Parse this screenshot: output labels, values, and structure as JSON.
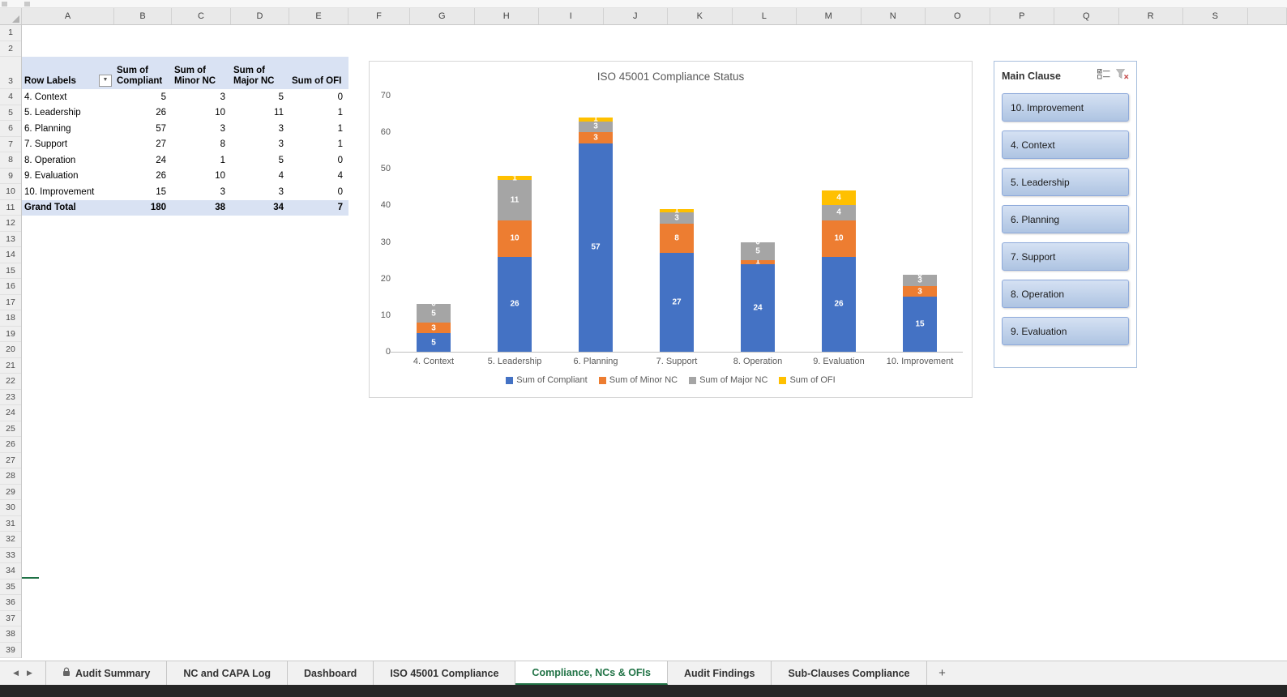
{
  "grid": {
    "columns": [
      "A",
      "B",
      "C",
      "D",
      "E",
      "F",
      "G",
      "H",
      "I",
      "J",
      "K",
      "L",
      "M",
      "N",
      "O",
      "P",
      "Q",
      "R",
      "S"
    ],
    "rows": [
      "1",
      "2",
      "3",
      "4",
      "5",
      "6",
      "7",
      "8",
      "9",
      "10",
      "11",
      "12",
      "13",
      "14",
      "15",
      "16",
      "17",
      "18",
      "19",
      "20",
      "21",
      "22",
      "23",
      "24",
      "25",
      "26",
      "27",
      "28",
      "29",
      "30",
      "31",
      "32",
      "33",
      "34",
      "35",
      "36",
      "37",
      "38",
      "39"
    ]
  },
  "icons": {
    "filter_dropdown": "▼",
    "tab_scroll_left": "◀",
    "tab_scroll_right": "▶",
    "select_all_corner": "corner-triangle",
    "slicer_multiselect": "multiselect-icon",
    "slicer_clear_filter": "clear-filter-icon",
    "sheet_lock": "lock-icon"
  },
  "pivot_table": {
    "columns": [
      "Row Labels",
      "Sum of Compliant",
      "Sum of Minor NC",
      "Sum of Major NC",
      "Sum of OFI"
    ],
    "rows": [
      {
        "label": "4. Context",
        "values": [
          5,
          3,
          5,
          0
        ]
      },
      {
        "label": "5. Leadership",
        "values": [
          26,
          10,
          11,
          1
        ]
      },
      {
        "label": "6. Planning",
        "values": [
          57,
          3,
          3,
          1
        ]
      },
      {
        "label": "7. Support",
        "values": [
          27,
          8,
          3,
          1
        ]
      },
      {
        "label": "8. Operation",
        "values": [
          24,
          1,
          5,
          0
        ]
      },
      {
        "label": "9. Evaluation",
        "values": [
          26,
          10,
          4,
          4
        ]
      },
      {
        "label": "10. Improvement",
        "values": [
          15,
          3,
          3,
          0
        ]
      }
    ],
    "grand_total": {
      "label": "Grand Total",
      "values": [
        180,
        38,
        34,
        7
      ]
    }
  },
  "chart_data": {
    "type": "bar",
    "stacked": true,
    "title": "ISO 45001 Compliance Status",
    "categories": [
      "4. Context",
      "5. Leadership",
      "6. Planning",
      "7. Support",
      "8. Operation",
      "9. Evaluation",
      "10. Improvement"
    ],
    "series": [
      {
        "name": "Sum of Compliant",
        "color": "#4472C4",
        "values": [
          5,
          26,
          57,
          27,
          24,
          26,
          15
        ]
      },
      {
        "name": "Sum of Minor NC",
        "color": "#ED7D31",
        "values": [
          3,
          10,
          3,
          8,
          1,
          10,
          3
        ]
      },
      {
        "name": "Sum of Major NC",
        "color": "#A5A5A5",
        "values": [
          5,
          11,
          3,
          3,
          5,
          4,
          3
        ]
      },
      {
        "name": "Sum of OFI",
        "color": "#FFC000",
        "values": [
          0,
          1,
          1,
          1,
          0,
          4,
          0
        ]
      }
    ],
    "ylim": [
      0,
      70
    ],
    "yticks": [
      0,
      10,
      20,
      30,
      40,
      50,
      60,
      70
    ],
    "grid": false,
    "legend_position": "bottom",
    "data_labels": true
  },
  "slicer": {
    "title": "Main Clause",
    "items": [
      "10. Improvement",
      "4. Context",
      "5. Leadership",
      "6. Planning",
      "7. Support",
      "8. Operation",
      "9. Evaluation"
    ]
  },
  "sheet_bar": {
    "tabs": [
      {
        "label": "Audit Summary",
        "locked": true,
        "active": false
      },
      {
        "label": "NC and CAPA Log",
        "locked": false,
        "active": false
      },
      {
        "label": "Dashboard",
        "locked": false,
        "active": false
      },
      {
        "label": "ISO 45001 Compliance",
        "locked": false,
        "active": false
      },
      {
        "label": "Compliance, NCs & OFIs",
        "locked": false,
        "active": true
      },
      {
        "label": "Audit Findings",
        "locked": false,
        "active": false
      },
      {
        "label": "Sub-Clauses Compliance",
        "locked": false,
        "active": false
      }
    ],
    "add_label": "+"
  }
}
